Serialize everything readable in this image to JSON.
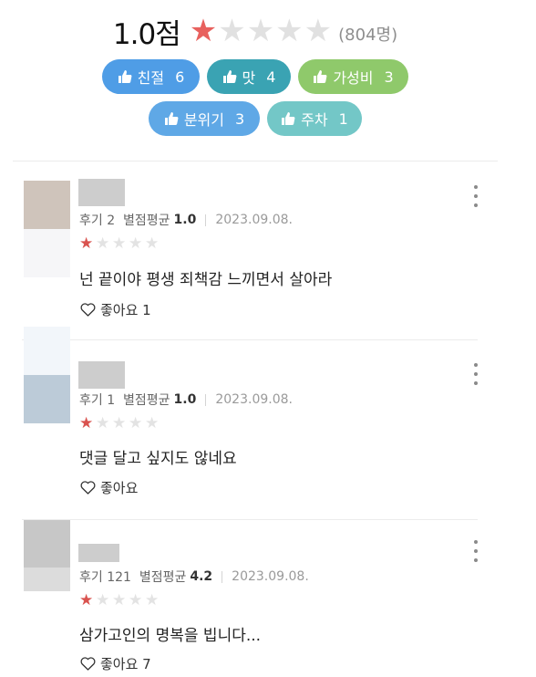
{
  "summary": {
    "score": "1.0점",
    "rating": 1,
    "max_rating": 5,
    "review_count": "(804명)"
  },
  "tags": [
    {
      "label": "친절",
      "count": "6",
      "color": "#4f9de6",
      "icon": "thumbs-up-icon"
    },
    {
      "label": "맛",
      "count": "4",
      "color": "#3aa3b3",
      "icon": "thumbs-up-icon"
    },
    {
      "label": "가성비",
      "count": "3",
      "color": "#8fc96b",
      "icon": "thumbs-up-icon"
    },
    {
      "label": "분위기",
      "count": "3",
      "color": "#5fa8e6",
      "icon": "thumbs-up-icon"
    },
    {
      "label": "주차",
      "count": "1",
      "color": "#73c7c7",
      "icon": "thumbs-up-icon"
    }
  ],
  "reviews": [
    {
      "meta_prefix": "후기 2  별점평균",
      "avg": "1.0",
      "date": "2023.09.08.",
      "rating": 1,
      "text": "넌 끝이야 평생 죄책감 느끼면서 살아라",
      "like_label": "좋아요 1",
      "avatar_colors": [
        "#cfc4bb",
        "#f6f6f8"
      ]
    },
    {
      "meta_prefix": "후기 1  별점평균",
      "avg": "1.0",
      "date": "2023.09.08.",
      "rating": 1,
      "text": "댓글 달고 싶지도 않네요",
      "like_label": "좋아요",
      "avatar_colors": [
        "#f2f6fa",
        "#bccbd8"
      ]
    },
    {
      "meta_prefix": "후기 121  별점평균",
      "avg": "4.2",
      "date": "2023.09.08.",
      "rating": 1,
      "text": "삼가고인의 명복을 빕니다...",
      "like_label": "좋아요 7",
      "avatar_colors": [
        "#c7c7c7",
        "#dcdcdc"
      ]
    }
  ],
  "icons": {
    "star": "star-icon",
    "heart": "heart-outline-icon",
    "more": "more-vertical-icon"
  },
  "colors": {
    "star_on": "#e8615e",
    "star_off": "#e1e1e1"
  }
}
